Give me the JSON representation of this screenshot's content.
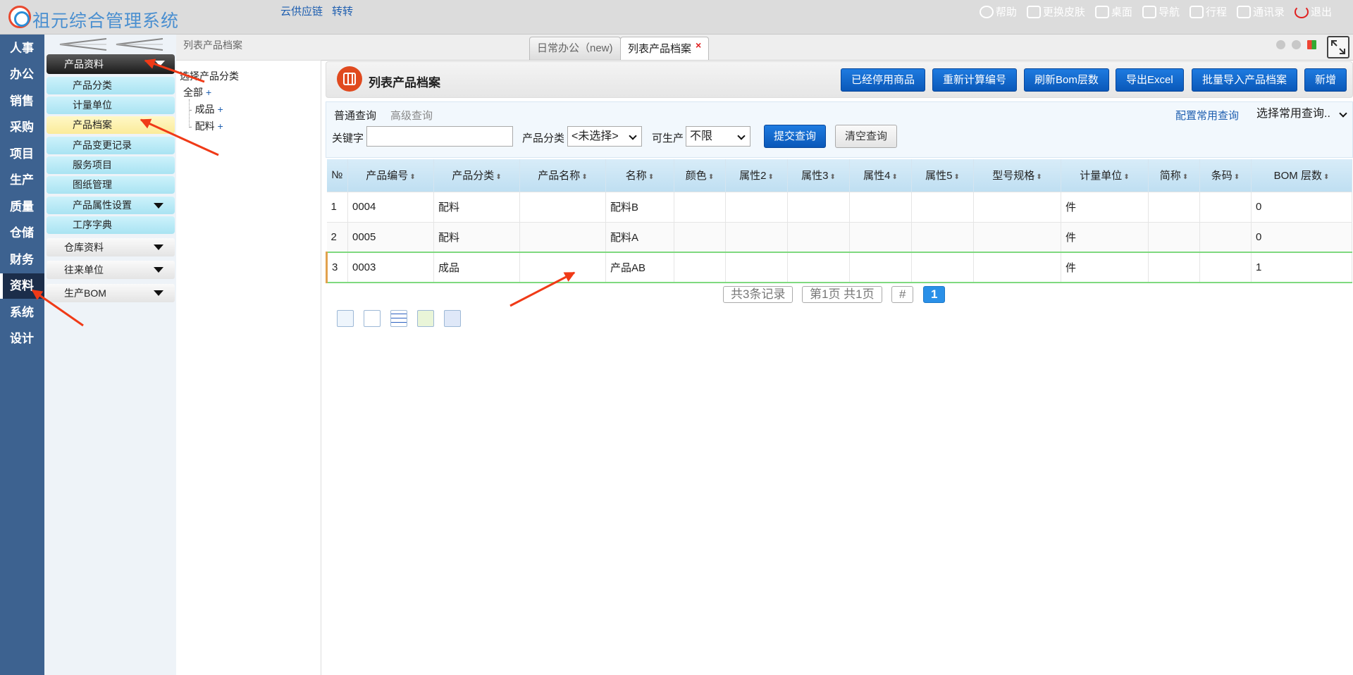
{
  "app": {
    "title": "祖元综合管理系统",
    "top_links": [
      "云供应链",
      "转转"
    ],
    "top_actions": [
      {
        "label": "帮助",
        "icon": "help-icon"
      },
      {
        "label": "更换皮肤",
        "icon": "shirt-icon"
      },
      {
        "label": "桌面",
        "icon": "home-icon"
      },
      {
        "label": "导航",
        "icon": "grid-icon"
      },
      {
        "label": "行程",
        "icon": "calendar-icon"
      },
      {
        "label": "通讯录",
        "icon": "contacts-icon"
      },
      {
        "label": "退出",
        "icon": "power-icon"
      }
    ]
  },
  "left_nav": [
    "人事",
    "办公",
    "销售",
    "采购",
    "项目",
    "生产",
    "质量",
    "仓储",
    "财务",
    "资料",
    "系统",
    "设计"
  ],
  "left_nav_active": "资料",
  "sidebar": {
    "header": "产品资料",
    "items": [
      "产品分类",
      "计量单位",
      "产品档案",
      "产品变更记录",
      "服务项目",
      "图纸管理",
      "产品属性设置",
      "工序字典"
    ],
    "selected": "产品档案",
    "groups": [
      "仓库资料",
      "往来单位",
      "生产BOM"
    ]
  },
  "tree": {
    "header": "列表产品档案",
    "title": "选择产品分类",
    "root": "全部",
    "children": [
      "成品",
      "配料"
    ],
    "plus": "+"
  },
  "tabs": [
    {
      "label": "日常办公（new)",
      "active": false
    },
    {
      "label": "列表产品档案",
      "active": true
    }
  ],
  "tab_close": "×",
  "page": {
    "title": "列表产品档案",
    "buttons": [
      "已经停用商品",
      "重新计算编号",
      "刷新Bom层数",
      "导出Excel",
      "批量导入产品档案",
      "新增"
    ]
  },
  "query": {
    "tabs": [
      "普通查询",
      "高级查询"
    ],
    "config_link": "配置常用查询",
    "common_select": "选择常用查询..",
    "keyword_label": "关键字",
    "keyword_value": "",
    "category_label": "产品分类",
    "category_value": "<未选择>",
    "producible_label": "可生产",
    "producible_value": "不限",
    "submit": "提交查询",
    "clear": "清空查询"
  },
  "table": {
    "columns": [
      "№",
      "产品编号",
      "产品分类",
      "产品名称",
      "名称",
      "颜色",
      "属性2",
      "属性3",
      "属性4",
      "属性5",
      "型号规格",
      "计量单位",
      "简称",
      "条码",
      "BOM 层数"
    ],
    "rows": [
      [
        "1",
        "0004",
        "配料",
        "",
        "配料B",
        "",
        "",
        "",
        "",
        "",
        "",
        "件",
        "",
        "",
        "0"
      ],
      [
        "2",
        "0005",
        "配料",
        "",
        "配料A",
        "",
        "",
        "",
        "",
        "",
        "",
        "件",
        "",
        "",
        "0"
      ],
      [
        "3",
        "0003",
        "成品",
        "",
        "产品AB",
        "",
        "",
        "",
        "",
        "",
        "",
        "件",
        "",
        "",
        "1"
      ]
    ],
    "selected_row": 2
  },
  "pager": {
    "records": "共3条记录",
    "pages": "第1页 共1页",
    "hash": "#",
    "current": "1"
  },
  "colors": {
    "nav_bg": "#3d6290",
    "nav_active": "#1b2d4a",
    "primary_button": "#0a58b9",
    "header_blue": "#4a8fd0",
    "annotation_arrow": "#f03a17"
  }
}
